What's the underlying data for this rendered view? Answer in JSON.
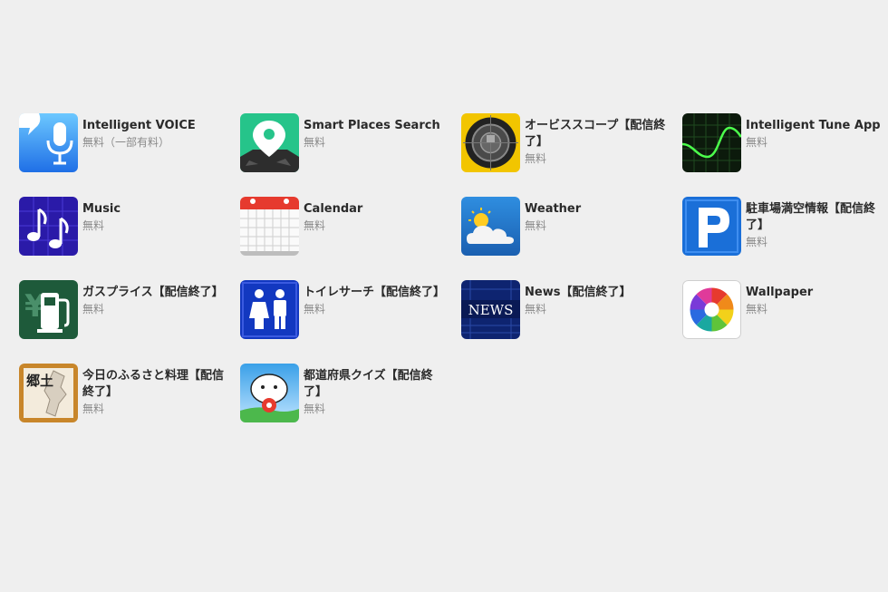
{
  "apps": [
    {
      "name": "Intelligent VOICE",
      "price": "無料（一部有料）",
      "icon": "microphone-icon"
    },
    {
      "name": "Smart Places Search",
      "price": "無料",
      "icon": "map-pin-icon"
    },
    {
      "name": "オービススコープ【配信終了】",
      "price": "無料",
      "icon": "radar-scope-icon"
    },
    {
      "name": "Intelligent Tune App",
      "price": "無料",
      "icon": "waveform-icon"
    },
    {
      "name": "Music",
      "price": "無料",
      "icon": "music-notes-icon"
    },
    {
      "name": "Calendar",
      "price": "無料",
      "icon": "calendar-icon"
    },
    {
      "name": "Weather",
      "price": "無料",
      "icon": "weather-cloud-sun-icon"
    },
    {
      "name": "駐車場満空情報【配信終了】",
      "price": "無料",
      "icon": "parking-icon"
    },
    {
      "name": "ガスプライス【配信終了】",
      "price": "無料",
      "icon": "fuel-pump-icon"
    },
    {
      "name": "トイレサーチ【配信終了】",
      "price": "無料",
      "icon": "restroom-icon"
    },
    {
      "name": "News【配信終了】",
      "price": "無料",
      "icon": "news-icon"
    },
    {
      "name": "Wallpaper",
      "price": "無料",
      "icon": "color-wheel-icon"
    },
    {
      "name": "今日のふるさと料理【配信終了】",
      "price": "無料",
      "icon": "kyodo-icon"
    },
    {
      "name": "都道府県クイズ【配信終了】",
      "price": "無料",
      "icon": "quiz-mascot-icon"
    }
  ],
  "kyodo_icon_text": "郷土"
}
